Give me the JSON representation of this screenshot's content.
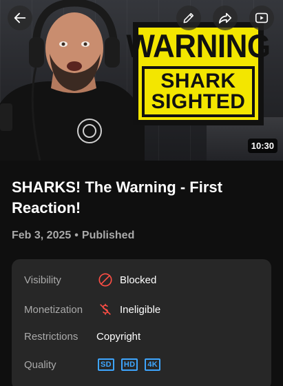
{
  "thumbnail": {
    "sign_top": "WARNING",
    "sign_line1": "SHARK",
    "sign_line2": "SIGHTED",
    "duration": "10:30"
  },
  "header": {
    "icons": [
      "back-arrow-icon",
      "pencil-icon",
      "share-icon",
      "youtube-play-icon"
    ]
  },
  "video": {
    "title": "SHARKS! The Warning - First Reaction!",
    "date": "Feb 3, 2025",
    "separator": "•",
    "status": "Published"
  },
  "details": {
    "visibility": {
      "label": "Visibility",
      "value": "Blocked",
      "icon": "blocked-icon",
      "color": "#ff4e45"
    },
    "monetization": {
      "label": "Monetization",
      "value": "Ineligible",
      "icon": "monetization-off-icon",
      "color": "#ff4e45"
    },
    "restrictions": {
      "label": "Restrictions",
      "value": "Copyright"
    },
    "quality": {
      "label": "Quality",
      "badges": [
        "SD",
        "HD",
        "4K"
      ],
      "color": "#3ea6ff"
    }
  }
}
